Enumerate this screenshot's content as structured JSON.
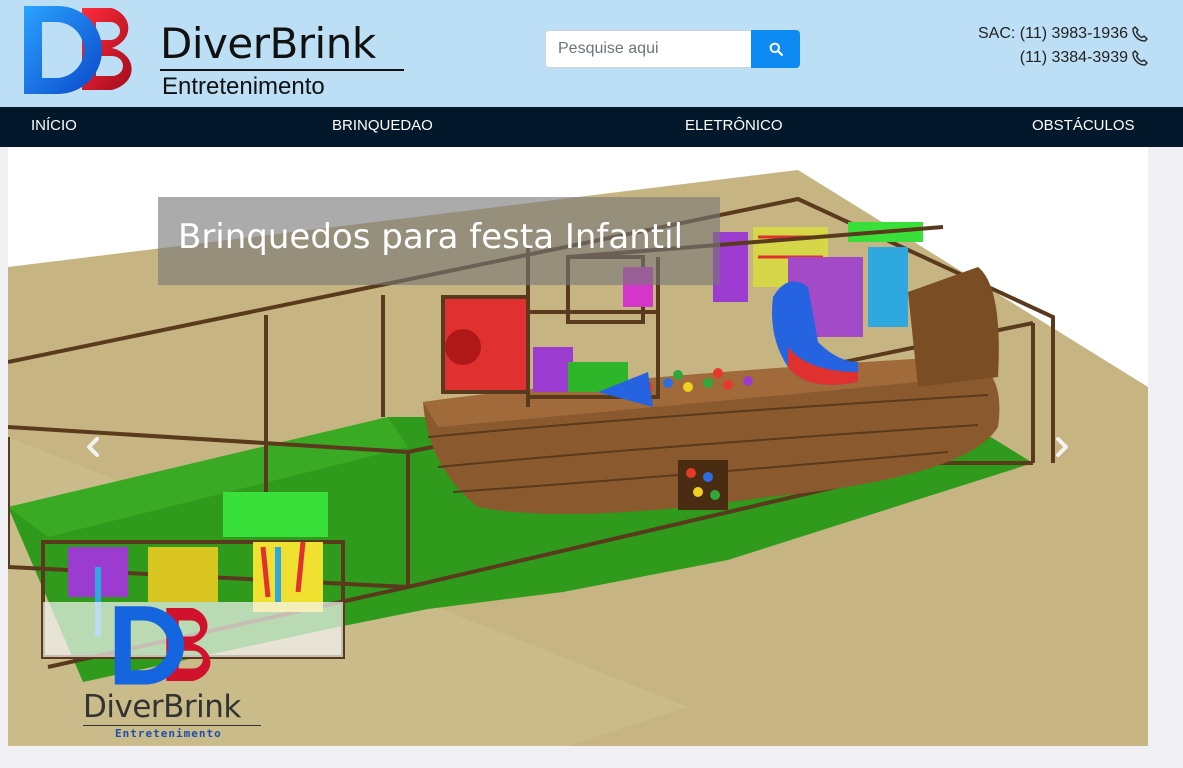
{
  "header": {
    "brand_name": "DiverBrink",
    "brand_sub": "Entretenimento",
    "logo_letters": "DB"
  },
  "search": {
    "placeholder": "Pesquise aqui",
    "button_icon": "search-icon"
  },
  "contact": {
    "line1": "SAC: (11) 3983-1936",
    "line2": "(11) 3384-3939",
    "icon": "phone-icon"
  },
  "nav": {
    "items": [
      {
        "label": "INÍCIO"
      },
      {
        "label": "BRINQUEDAO"
      },
      {
        "label": "ELETRÔNICO"
      },
      {
        "label": "OBSTÁCULOS"
      }
    ]
  },
  "carousel": {
    "caption": "Brinquedos para festa Infantil",
    "prev_icon": "chevron-left-icon",
    "next_icon": "chevron-right-icon",
    "watermark": {
      "brand_name": "DiverBrink",
      "brand_sub": "Entretenimento"
    }
  },
  "colors": {
    "header_bg": "#bcdff6",
    "nav_bg": "#03182a",
    "search_button": "#0d8bf2",
    "logo_blue": "#1565e0",
    "logo_red": "#d0122c"
  }
}
